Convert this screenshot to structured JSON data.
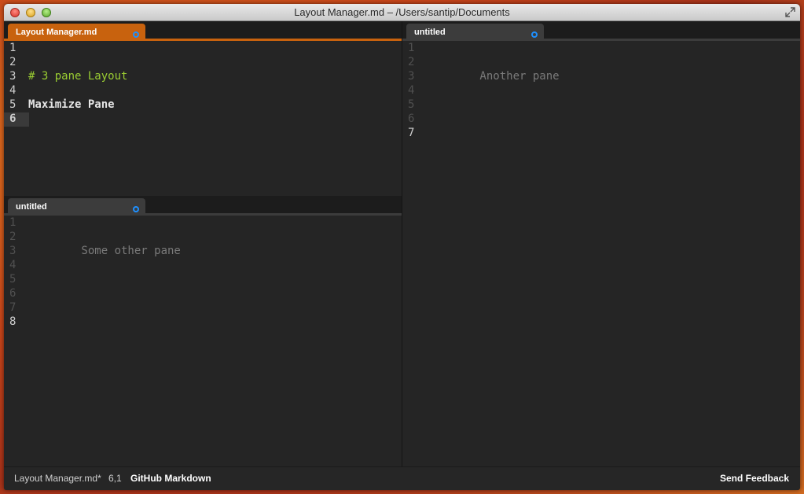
{
  "window": {
    "title": "Layout Manager.md – /Users/santip/Documents"
  },
  "panes": {
    "top_left": {
      "tab_label": "Layout Manager.md",
      "line_numbers": [
        "1",
        "2",
        "3",
        "4",
        "5",
        "6"
      ],
      "lines": {
        "3": "# 3 pane Layout",
        "5": "Maximize Pane"
      },
      "current_line": "6"
    },
    "bottom_left": {
      "tab_label": "untitled",
      "line_numbers": [
        "1",
        "2",
        "3",
        "4",
        "5",
        "6",
        "7",
        "8"
      ],
      "lines": {
        "3": "        Some other pane"
      }
    },
    "right": {
      "tab_label": "untitled",
      "line_numbers": [
        "1",
        "2",
        "3",
        "4",
        "5",
        "6",
        "7"
      ],
      "lines": {
        "3": "        Another pane"
      }
    }
  },
  "statusbar": {
    "file": "Layout Manager.md*",
    "cursor": "6,1",
    "grammar": "GitHub Markdown",
    "feedback": "Send Feedback"
  },
  "colors": {
    "active_tab": "#c8620e",
    "heading": "#9acd32",
    "modified_dot": "#1e90ff"
  }
}
